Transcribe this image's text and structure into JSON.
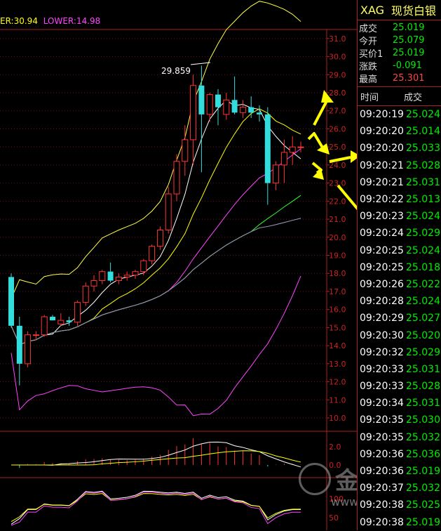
{
  "legend": {
    "upper": "ER:30.94",
    "lower": "LOWER:14.98",
    "upper_color": "#ffff00",
    "lower_color": "#ff44ff"
  },
  "header": {
    "symbol": "XAG",
    "name": "现货白银"
  },
  "quotes": [
    {
      "label": "成交",
      "value": "25.019",
      "color": "green"
    },
    {
      "label": "今开",
      "value": "25.079",
      "color": "green"
    },
    {
      "label": "买价1",
      "value": "25.019",
      "color": "green"
    },
    {
      "label": "涨跌",
      "value": "-0.091",
      "color": "green"
    },
    {
      "label": "最高",
      "value": "25.301",
      "color": "red"
    }
  ],
  "ticks_header": {
    "time": "时间",
    "price": "成交"
  },
  "ticks": [
    {
      "time": "09:20:19",
      "price": "25.024"
    },
    {
      "time": "09:20:20",
      "price": "25.014"
    },
    {
      "time": "09:20:20",
      "price": "25.033"
    },
    {
      "time": "09:20:21",
      "price": "25.028"
    },
    {
      "time": "09:20:21",
      "price": "25.031"
    },
    {
      "time": "09:20:22",
      "price": "25.013"
    },
    {
      "time": "09:20:23",
      "price": "25.024"
    },
    {
      "time": "09:20:24",
      "price": "25.029"
    },
    {
      "time": "09:20:25",
      "price": "25.024"
    },
    {
      "time": "09:20:25",
      "price": "25.018"
    },
    {
      "time": "09:20:26",
      "price": "25.022"
    },
    {
      "time": "09:20:28",
      "price": "25.024"
    },
    {
      "time": "09:20:29",
      "price": "25.027"
    },
    {
      "time": "09:20:30",
      "price": "25.020"
    },
    {
      "time": "09:20:32",
      "price": "25.029"
    },
    {
      "time": "09:20:33",
      "price": "25.031"
    },
    {
      "time": "09:20:33",
      "price": "25.028"
    },
    {
      "time": "09:20:34",
      "price": "25.031"
    },
    {
      "time": "09:20:35",
      "price": "25.030"
    },
    {
      "time": "09:20:35",
      "price": "25.032"
    },
    {
      "time": "09:20:36",
      "price": "25.036"
    },
    {
      "time": "09:20:36",
      "price": "25.019"
    },
    {
      "time": "09:20:37",
      "price": "25.032"
    },
    {
      "time": "09:20:38",
      "price": "25.025"
    },
    {
      "time": "09:20:38",
      "price": "25.019"
    }
  ],
  "watermark": {
    "text": "金融界",
    "url": "www.jrwei.com"
  },
  "chart_data": {
    "type": "candlestick",
    "ylim": [
      10.0,
      31.5
    ],
    "y_ticks": [
      "31.0",
      "30.0",
      "29.0",
      "28.0",
      "27.0",
      "26.0",
      "25.0",
      "24.0",
      "23.0",
      "22.0",
      "21.0",
      "20.0",
      "19.0",
      "18.0",
      "17.0",
      "16.0",
      "15.0",
      "14.0",
      "13.0",
      "12.0",
      "11.0",
      "10.0"
    ],
    "peak_label": "29.859",
    "candles": [
      {
        "o": 17.8,
        "h": 18.0,
        "l": 15.0,
        "c": 15.1
      },
      {
        "o": 15.1,
        "h": 15.6,
        "l": 11.8,
        "c": 13.0
      },
      {
        "o": 13.0,
        "h": 14.8,
        "l": 12.8,
        "c": 14.6
      },
      {
        "o": 14.6,
        "h": 14.8,
        "l": 14.3,
        "c": 14.6
      },
      {
        "o": 14.6,
        "h": 15.7,
        "l": 14.5,
        "c": 15.6
      },
      {
        "o": 15.6,
        "h": 15.7,
        "l": 15.4,
        "c": 15.4
      },
      {
        "o": 15.2,
        "h": 15.8,
        "l": 15.1,
        "c": 15.4
      },
      {
        "o": 15.4,
        "h": 15.6,
        "l": 15.1,
        "c": 15.3
      },
      {
        "o": 15.3,
        "h": 16.5,
        "l": 15.1,
        "c": 16.4
      },
      {
        "o": 16.4,
        "h": 17.5,
        "l": 16.2,
        "c": 17.3
      },
      {
        "o": 17.3,
        "h": 17.9,
        "l": 17.0,
        "c": 17.6
      },
      {
        "o": 17.6,
        "h": 18.2,
        "l": 17.4,
        "c": 18.1
      },
      {
        "o": 18.1,
        "h": 18.6,
        "l": 17.5,
        "c": 17.6
      },
      {
        "o": 17.6,
        "h": 18.0,
        "l": 17.4,
        "c": 17.8
      },
      {
        "o": 17.8,
        "h": 18.1,
        "l": 17.6,
        "c": 17.9
      },
      {
        "o": 17.9,
        "h": 18.2,
        "l": 17.7,
        "c": 18.1
      },
      {
        "o": 18.1,
        "h": 18.8,
        "l": 17.9,
        "c": 18.7
      },
      {
        "o": 18.7,
        "h": 19.6,
        "l": 18.5,
        "c": 19.5
      },
      {
        "o": 19.5,
        "h": 20.6,
        "l": 19.3,
        "c": 20.4
      },
      {
        "o": 20.4,
        "h": 22.8,
        "l": 20.2,
        "c": 22.4
      },
      {
        "o": 22.4,
        "h": 24.6,
        "l": 22.0,
        "c": 24.2
      },
      {
        "o": 24.2,
        "h": 26.2,
        "l": 23.4,
        "c": 25.4
      },
      {
        "o": 25.4,
        "h": 29.0,
        "l": 24.0,
        "c": 28.4
      },
      {
        "o": 28.4,
        "h": 29.5,
        "l": 23.6,
        "c": 26.8
      },
      {
        "o": 26.8,
        "h": 28.0,
        "l": 26.4,
        "c": 27.9
      },
      {
        "o": 27.9,
        "h": 28.2,
        "l": 26.2,
        "c": 27.2
      },
      {
        "o": 26.8,
        "h": 28.0,
        "l": 26.5,
        "c": 27.6
      },
      {
        "o": 27.6,
        "h": 28.9,
        "l": 26.8,
        "c": 26.9
      },
      {
        "o": 26.9,
        "h": 27.6,
        "l": 26.6,
        "c": 27.2
      },
      {
        "o": 27.2,
        "h": 27.8,
        "l": 26.6,
        "c": 26.9
      },
      {
        "o": 26.9,
        "h": 27.3,
        "l": 26.4,
        "c": 26.8
      },
      {
        "o": 26.8,
        "h": 27.2,
        "l": 21.8,
        "c": 23.0
      },
      {
        "o": 23.0,
        "h": 24.2,
        "l": 22.6,
        "c": 24.0
      },
      {
        "o": 24.0,
        "h": 25.4,
        "l": 23.0,
        "c": 24.7
      },
      {
        "o": 24.7,
        "h": 25.6,
        "l": 24.0,
        "c": 25.0
      },
      {
        "o": 25.0,
        "h": 25.3,
        "l": 24.7,
        "c": 25.0
      }
    ],
    "macd_axis_labels": [
      "2.0",
      "0.0"
    ],
    "kdj_axis_labels": [
      "100",
      "50"
    ]
  }
}
